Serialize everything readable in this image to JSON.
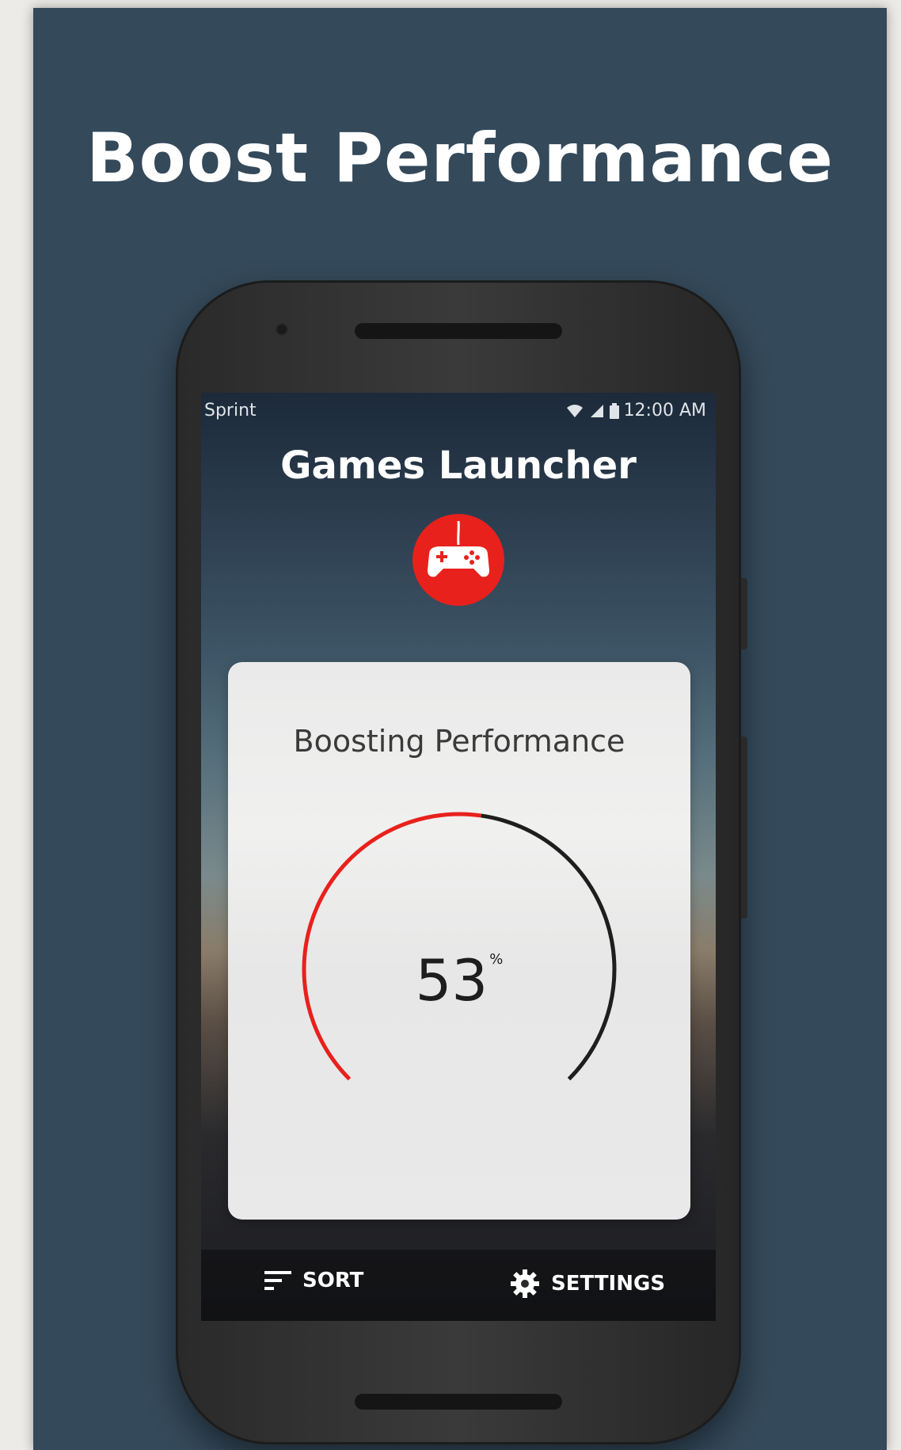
{
  "promo": {
    "headline": "Boost Performance"
  },
  "status_bar": {
    "carrier": "Sprint",
    "time": "12:00 AM",
    "icons": [
      "wifi-icon",
      "signal-icon",
      "battery-icon"
    ]
  },
  "app": {
    "title": "Games Launcher",
    "logo_icon": "gamepad-icon",
    "accent_color": "#e8211c"
  },
  "boost_panel": {
    "title": "Boosting Performance",
    "percent_value": "53",
    "percent_unit": "%",
    "progress_fraction": 0.53
  },
  "bottom_bar": {
    "sort_label": "SORT",
    "sort_icon": "sort-icon",
    "settings_label": "SETTINGS",
    "settings_icon": "gear-icon"
  },
  "colors": {
    "background": "#34495a",
    "gauge_progress": "#e8211c",
    "gauge_track": "#1e1e1e"
  }
}
